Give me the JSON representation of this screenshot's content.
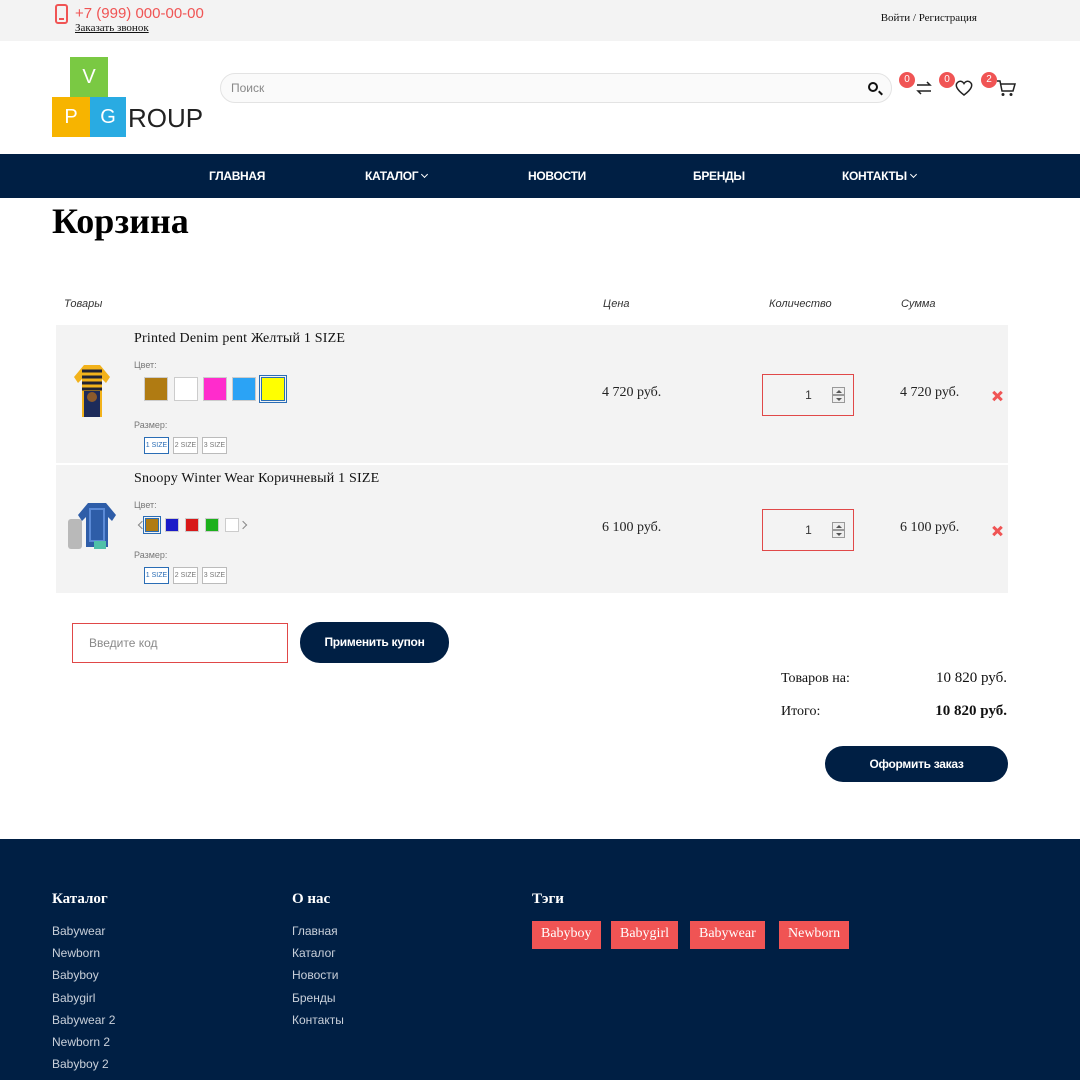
{
  "topbar": {
    "phone": "+7 (999) 000-00-00",
    "callback": "Заказать звонок",
    "login": "Войти",
    "separator": " / ",
    "register": "Регистрация"
  },
  "header": {
    "logo_v": "V",
    "logo_p": "P",
    "logo_g": "G",
    "logo_roup": "ROUP",
    "search_placeholder": "Поиск",
    "compare_count": "0",
    "wishlist_count": "0",
    "cart_count": "2"
  },
  "nav": [
    {
      "label": "ГЛАВНАЯ",
      "dropdown": false
    },
    {
      "label": "КАТАЛОГ",
      "dropdown": true
    },
    {
      "label": "НОВОСТИ",
      "dropdown": false
    },
    {
      "label": "БРЕНДЫ",
      "dropdown": false
    },
    {
      "label": "КОНТАКТЫ",
      "dropdown": true
    }
  ],
  "cart": {
    "title": "Корзина",
    "columns": {
      "products": "Товары",
      "price": "Цена",
      "quantity": "Количество",
      "sum": "Сумма"
    },
    "color_label": "Цвет:",
    "size_label": "Размер:",
    "items": [
      {
        "name": "Printed Denim pent Желтый 1 SIZE",
        "colors": [
          "#b07b12",
          "#ffffff",
          "#ff2ccc",
          "#2ba3f5",
          "#ffff00"
        ],
        "selected_color": 4,
        "sizes": [
          "1 SIZE",
          "2 SIZE",
          "3 SIZE"
        ],
        "selected_size": 0,
        "price": "4 720 руб.",
        "quantity": "1",
        "sum": "4 720 руб."
      },
      {
        "name": "Snoopy Winter Wear Коричневый 1 SIZE",
        "colors": [
          "#b07b12",
          "#1a1ac8",
          "#d81818",
          "#1cb01c",
          "#ffffff"
        ],
        "selected_color": 0,
        "sizes": [
          "1 SIZE",
          "2 SIZE",
          "3 SIZE"
        ],
        "selected_size": 0,
        "price": "6 100 руб.",
        "quantity": "1",
        "sum": "6 100 руб."
      }
    ],
    "coupon_placeholder": "Введите код",
    "apply_label": "Применить купон",
    "goods_label": "Товаров на:",
    "goods_value": "10 820 руб.",
    "total_label": "Итого:",
    "total_value": "10 820 руб.",
    "checkout_label": "Оформить заказ"
  },
  "footer": {
    "catalog_title": "Каталог",
    "catalog_links": [
      "Babywear",
      "Newborn",
      "Babyboy",
      "Babygirl",
      "Babywear 2",
      "Newborn 2",
      "Babyboy 2"
    ],
    "about_title": "О нас",
    "about_links": [
      "Главная",
      "Каталог",
      "Новости",
      "Бренды",
      "Контакты"
    ],
    "tags_title": "Тэги",
    "tags": [
      "Babyboy",
      "Babygirl",
      "Babywear",
      "Newborn"
    ]
  },
  "colors": {
    "accent": "#f05454",
    "navy": "#001f44",
    "row_bg": "#f3f3f3"
  }
}
